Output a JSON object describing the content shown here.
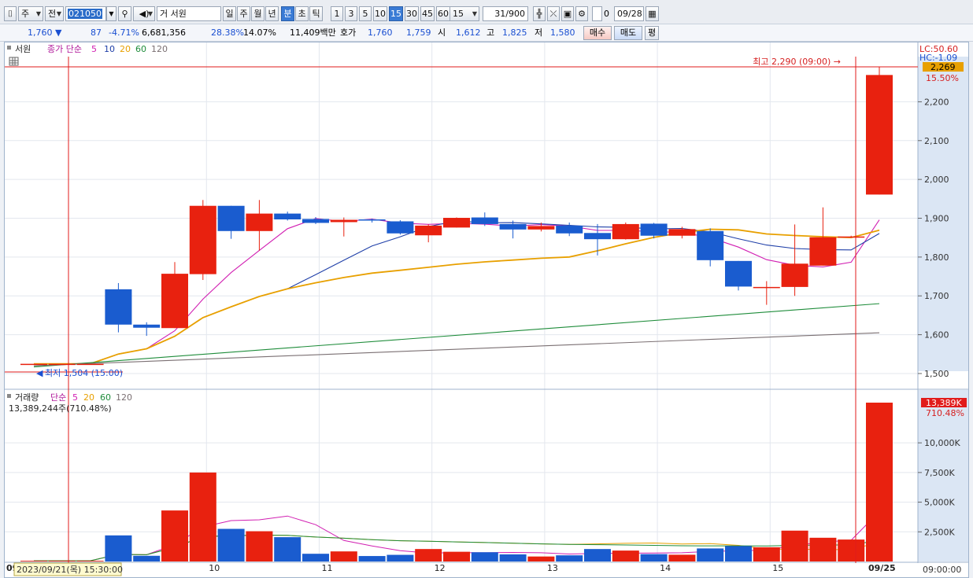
{
  "toolbar": {
    "market": "주",
    "scope": "전",
    "stock_code": "021050",
    "stock_name": "서원",
    "periods": [
      "일",
      "주",
      "월",
      "년",
      "분",
      "초",
      "틱"
    ],
    "active_period": "분",
    "intervals": [
      "1",
      "3",
      "5",
      "10",
      "15",
      "30",
      "45",
      "60"
    ],
    "active_interval": "15",
    "interval_select": "15",
    "count": "31/900",
    "checkbox_label": "0",
    "date": "09/28"
  },
  "quote": {
    "price": "1,760",
    "change_arrow": "▼",
    "change": "87",
    "change_pct": "-4.71%",
    "volume": "6,681,356",
    "pct1": "28.38%",
    "pct2": "14.07%",
    "amount": "11,409백만",
    "hoga_label": "호가",
    "hoga_ask": "1,760",
    "hoga_bid": "1,759",
    "open_label": "시",
    "open": "1,612",
    "high_label": "고",
    "high": "1,825",
    "low_label": "저",
    "low": "1,580",
    "buy_button": "매수",
    "sell_button": "매도",
    "avg_button": "평"
  },
  "price_panel": {
    "legend_name": "서원",
    "legend_type": "종가 단순",
    "ma_periods": [
      "5",
      "10",
      "20",
      "60",
      "120"
    ],
    "ma_colors": [
      "#d11fb2",
      "#1f3fa8",
      "#e8a000",
      "#1e8c3a",
      "#7a6f72"
    ],
    "lc_label": "LC:50.60",
    "hc_label": "HC:-1.09",
    "high_annotation": "최고 2,290 (09:00) →",
    "low_annotation": "최저 1,504 (15:00)",
    "current_price_tag": "2,269",
    "current_pct_tag": "15.50%",
    "y_ticks": [
      "2,200",
      "2,100",
      "2,000",
      "1,900",
      "1,800",
      "1,700",
      "1,600",
      "1,500"
    ]
  },
  "volume_panel": {
    "legend_name": "거래량",
    "legend_type": "단순",
    "ma_periods": [
      "5",
      "20",
      "60",
      "120"
    ],
    "summary": "13,389,244주(710.48%)",
    "current_tag": "13,389K",
    "current_pct_tag": "710.48%",
    "y_ticks": [
      "10,000K",
      "7,500K",
      "5,000K",
      "2,500K"
    ]
  },
  "x_axis": {
    "labels": [
      "09",
      "10",
      "11",
      "12",
      "13",
      "14",
      "15",
      "09/25"
    ],
    "crosshair_label": "2023/09/21(목) 15:30:00",
    "time_label": "09:00:00"
  },
  "chart_data": {
    "type": "candlestick",
    "up_color": "#e8210f",
    "down_color": "#1a5ccf",
    "candles": [
      {
        "o": 1525,
        "h": 1525,
        "l": 1525,
        "c": 1525,
        "v": 60
      },
      {
        "o": 1525,
        "h": 1525,
        "l": 1525,
        "c": 1525,
        "v": 60
      },
      {
        "o": 1525,
        "h": 1525,
        "l": 1525,
        "c": 1525,
        "v": 60
      },
      {
        "o": 1717,
        "h": 1733,
        "l": 1606,
        "c": 1626,
        "v": 2200
      },
      {
        "o": 1626,
        "h": 1632,
        "l": 1597,
        "c": 1618,
        "v": 480
      },
      {
        "o": 1617,
        "h": 1787,
        "l": 1617,
        "c": 1757,
        "v": 4300
      },
      {
        "o": 1756,
        "h": 1947,
        "l": 1741,
        "c": 1932,
        "v": 7500
      },
      {
        "o": 1932,
        "h": 1932,
        "l": 1847,
        "c": 1867,
        "v": 2750
      },
      {
        "o": 1867,
        "h": 1947,
        "l": 1817,
        "c": 1912,
        "v": 2550
      },
      {
        "o": 1912,
        "h": 1917,
        "l": 1894,
        "c": 1897,
        "v": 2050
      },
      {
        "o": 1898,
        "h": 1903,
        "l": 1885,
        "c": 1888,
        "v": 650
      },
      {
        "o": 1890,
        "h": 1902,
        "l": 1853,
        "c": 1896,
        "v": 850
      },
      {
        "o": 1897,
        "h": 1899,
        "l": 1889,
        "c": 1895,
        "v": 460
      },
      {
        "o": 1892,
        "h": 1895,
        "l": 1858,
        "c": 1861,
        "v": 560
      },
      {
        "o": 1856,
        "h": 1884,
        "l": 1838,
        "c": 1881,
        "v": 1050
      },
      {
        "o": 1876,
        "h": 1902,
        "l": 1876,
        "c": 1901,
        "v": 820
      },
      {
        "o": 1902,
        "h": 1915,
        "l": 1880,
        "c": 1885,
        "v": 780
      },
      {
        "o": 1885,
        "h": 1894,
        "l": 1848,
        "c": 1871,
        "v": 600
      },
      {
        "o": 1871,
        "h": 1889,
        "l": 1866,
        "c": 1880,
        "v": 420
      },
      {
        "o": 1881,
        "h": 1889,
        "l": 1854,
        "c": 1861,
        "v": 520
      },
      {
        "o": 1862,
        "h": 1885,
        "l": 1804,
        "c": 1846,
        "v": 1050
      },
      {
        "o": 1846,
        "h": 1889,
        "l": 1845,
        "c": 1885,
        "v": 920
      },
      {
        "o": 1886,
        "h": 1888,
        "l": 1848,
        "c": 1855,
        "v": 620
      },
      {
        "o": 1855,
        "h": 1878,
        "l": 1848,
        "c": 1872,
        "v": 570
      },
      {
        "o": 1867,
        "h": 1874,
        "l": 1776,
        "c": 1792,
        "v": 1100
      },
      {
        "o": 1790,
        "h": 1790,
        "l": 1714,
        "c": 1724,
        "v": 1300
      },
      {
        "o": 1723,
        "h": 1738,
        "l": 1677,
        "c": 1723,
        "v": 1200
      },
      {
        "o": 1723,
        "h": 1884,
        "l": 1700,
        "c": 1783,
        "v": 2600
      },
      {
        "o": 1778,
        "h": 1928,
        "l": 1778,
        "c": 1851,
        "v": 2000
      },
      {
        "o": 1850,
        "h": 1855,
        "l": 1850,
        "c": 1853,
        "v": 1850
      },
      {
        "o": 1961,
        "h": 2290,
        "l": 1961,
        "c": 2269,
        "v": 13389
      }
    ]
  }
}
